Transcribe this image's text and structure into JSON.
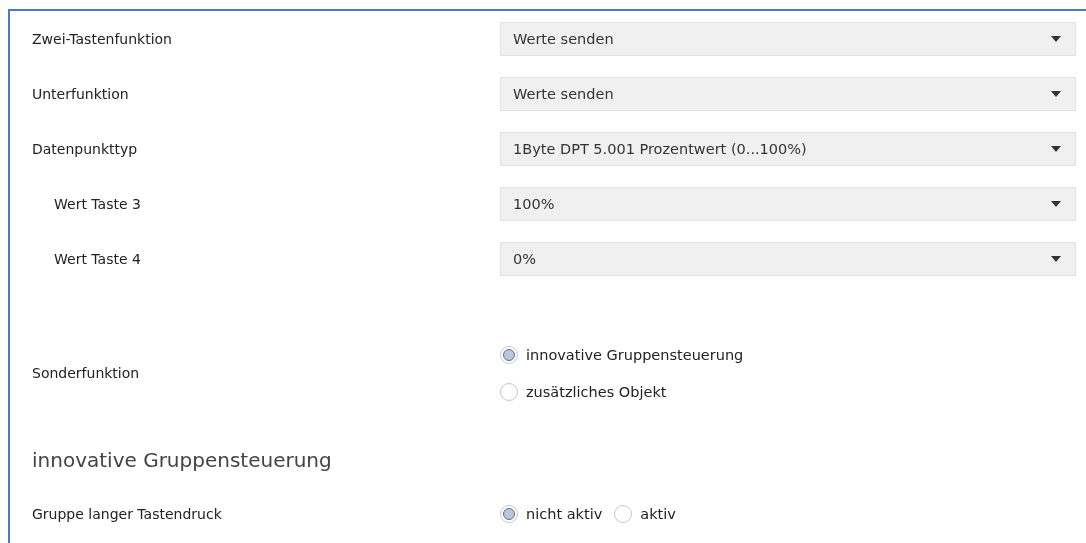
{
  "rows": [
    {
      "kind": "select",
      "label": "Zwei-Tastenfunktion",
      "indented": false,
      "value": "Werte senden"
    },
    {
      "kind": "select",
      "label": "Unterfunktion",
      "indented": false,
      "value": "Werte senden"
    },
    {
      "kind": "select",
      "label": "Datenpunkttyp",
      "indented": false,
      "value": "1Byte DPT 5.001 Prozentwert (0...100%)"
    },
    {
      "kind": "select",
      "label": "Wert Taste 3",
      "indented": true,
      "value": "100%"
    },
    {
      "kind": "select",
      "label": "Wert Taste 4",
      "indented": true,
      "value": "0%"
    },
    {
      "kind": "radio-column",
      "label": "Sonderfunktion",
      "indented": false,
      "options": [
        {
          "label": "innovative Gruppensteuerung",
          "selected": true
        },
        {
          "label": "zusätzliches Objekt",
          "selected": false
        }
      ]
    },
    {
      "kind": "heading",
      "label": "innovative Gruppensteuerung"
    },
    {
      "kind": "radio-row",
      "label": "Gruppe langer Tastendruck",
      "indented": false,
      "options": [
        {
          "label": "nicht aktiv",
          "selected": true
        },
        {
          "label": "aktiv",
          "selected": false
        }
      ]
    }
  ]
}
